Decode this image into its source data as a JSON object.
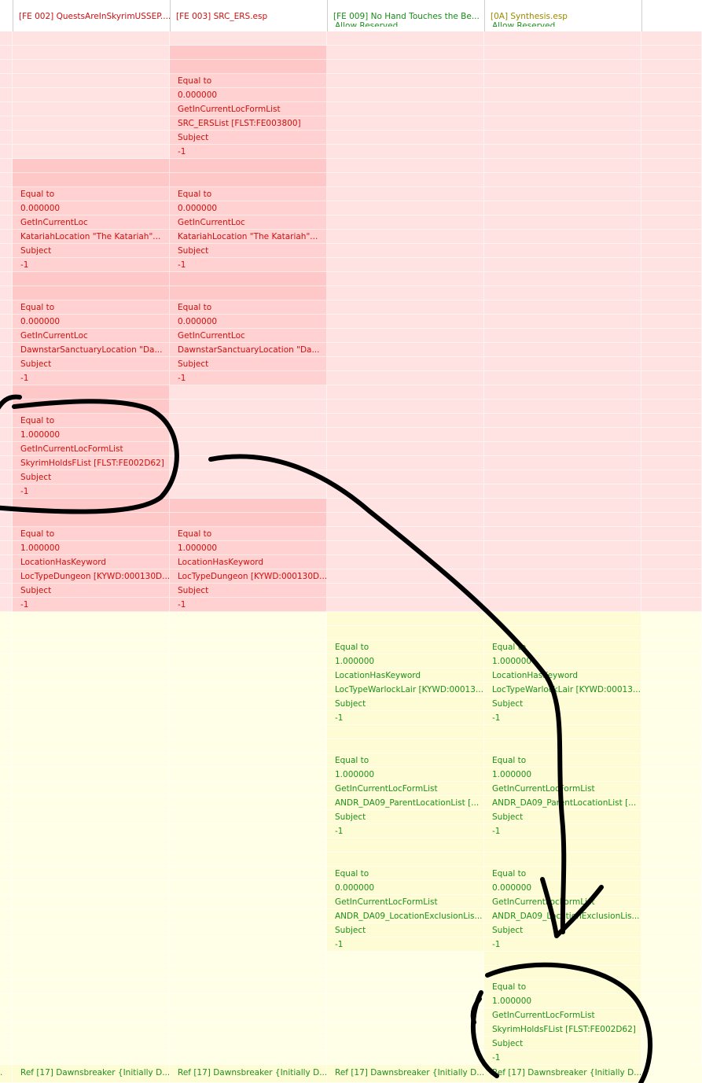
{
  "headers": [
    {
      "label": "",
      "color": "#cc1111"
    },
    {
      "label": "[FE 002] QuestsAreInSkyrimUSSEP....",
      "color": "#cc1111"
    },
    {
      "label": "[FE 003] SRC_ERS.esp",
      "color": "#cc1111"
    },
    {
      "label": "[FE 009] No Hand Touches the Be...",
      "color": "#1a8a1a"
    },
    {
      "label": "[0A] Synthesis.esp",
      "color": "#9a8a00"
    }
  ],
  "truncated_header_text": "Allow Reserved",
  "colors": {
    "conflict_bg": "#ffe3e3",
    "conflict_text": "#cc1111",
    "conflict_filled": "#ffd1d1",
    "conflict_sep": "#ffc8c8",
    "override_bg": "#fffee6",
    "override_filled": "#fdfcd4",
    "override_text": "#1f8f1f",
    "annotation_ink": "#000000"
  },
  "condition_groups": [
    {
      "row": 3,
      "columns": {
        "2": [
          "Equal to",
          "0.000000",
          "GetInCurrentLocFormList",
          "SRC_ERSList [FLST:FE003800]",
          "Subject",
          "-1"
        ]
      }
    },
    {
      "row": 11,
      "columns": {
        "1": [
          "Equal to",
          "0.000000",
          "GetInCurrentLoc",
          "KatariahLocation \"The Katariah\"...",
          "Subject",
          "-1"
        ],
        "2": [
          "Equal to",
          "0.000000",
          "GetInCurrentLoc",
          "KatariahLocation \"The Katariah\"...",
          "Subject",
          "-1"
        ]
      }
    },
    {
      "row": 19,
      "columns": {
        "1": [
          "Equal to",
          "0.000000",
          "GetInCurrentLoc",
          "DawnstarSanctuaryLocation \"Da...",
          "Subject",
          "-1"
        ],
        "2": [
          "Equal to",
          "0.000000",
          "GetInCurrentLoc",
          "DawnstarSanctuaryLocation \"Da...",
          "Subject",
          "-1"
        ]
      }
    },
    {
      "row": 27,
      "columns": {
        "1": [
          "Equal to",
          "1.000000",
          "GetInCurrentLocFormList",
          "SkyrimHoldsFList [FLST:FE002D62]",
          "Subject",
          "-1"
        ]
      }
    },
    {
      "row": 35,
      "columns": {
        "1": [
          "Equal to",
          "1.000000",
          "LocationHasKeyword",
          "LocTypeDungeon [KYWD:000130D...",
          "Subject",
          "-1"
        ],
        "2": [
          "Equal to",
          "1.000000",
          "LocationHasKeyword",
          "LocTypeDungeon [KYWD:000130D...",
          "Subject",
          "-1"
        ]
      }
    },
    {
      "row": 43,
      "columns": {
        "3": [
          "Equal to",
          "1.000000",
          "LocationHasKeyword",
          "LocTypeWarlockLair [KYWD:00013...",
          "Subject",
          "-1"
        ],
        "4": [
          "Equal to",
          "1.000000",
          "LocationHasKeyword",
          "LocTypeWarlockLair [KYWD:00013...",
          "Subject",
          "-1"
        ]
      }
    },
    {
      "row": 51,
      "columns": {
        "3": [
          "Equal to",
          "1.000000",
          "GetInCurrentLocFormList",
          "ANDR_DA09_ParentLocationList [...",
          "Subject",
          "-1"
        ],
        "4": [
          "Equal to",
          "1.000000",
          "GetInCurrentLocFormList",
          "ANDR_DA09_ParentLocationList [...",
          "Subject",
          "-1"
        ]
      }
    },
    {
      "row": 59,
      "columns": {
        "3": [
          "Equal to",
          "0.000000",
          "GetInCurrentLocFormList",
          "ANDR_DA09_LocationExclusionLis...",
          "Subject",
          "-1"
        ],
        "4": [
          "Equal to",
          "0.000000",
          "GetInCurrentLocFormList",
          "ANDR_DA09_LocationExclusionLis...",
          "Subject",
          "-1"
        ]
      }
    },
    {
      "row": 67,
      "columns": {
        "4": [
          "Equal to",
          "1.000000",
          "GetInCurrentLocFormList",
          "SkyrimHoldsFList [FLST:FE002D62]",
          "Subject",
          "-1"
        ]
      }
    }
  ],
  "bottom_row": [
    ".",
    "Ref [17] Dawnsbreaker {Initially D...",
    "Ref [17] Dawnsbreaker {Initially D...",
    "Ref [17] Dawnsbreaker {Initially D...",
    "Ref [17] Dawnsbreaker {Initially D..."
  ]
}
